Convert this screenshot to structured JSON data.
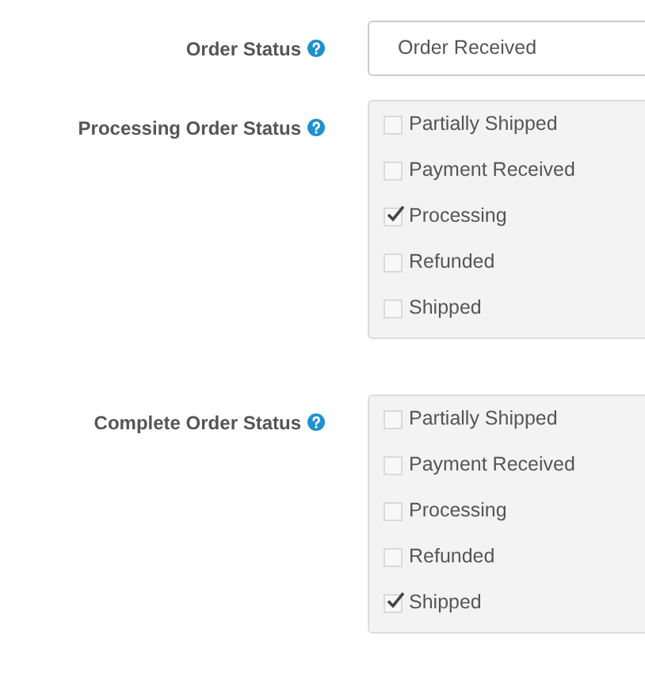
{
  "fields": [
    {
      "kind": "select",
      "label": "Order Status",
      "value": "Order Received"
    },
    {
      "kind": "checklist",
      "label": "Processing Order Status",
      "options": [
        {
          "label": "Partially Shipped",
          "checked": false
        },
        {
          "label": "Payment Received",
          "checked": false
        },
        {
          "label": "Processing",
          "checked": true
        },
        {
          "label": "Refunded",
          "checked": false
        },
        {
          "label": "Shipped",
          "checked": false
        }
      ]
    },
    {
      "kind": "checklist",
      "label": "Complete Order Status",
      "options": [
        {
          "label": "Partially Shipped",
          "checked": false
        },
        {
          "label": "Payment Received",
          "checked": false
        },
        {
          "label": "Processing",
          "checked": false
        },
        {
          "label": "Refunded",
          "checked": false
        },
        {
          "label": "Shipped",
          "checked": true
        }
      ]
    }
  ]
}
